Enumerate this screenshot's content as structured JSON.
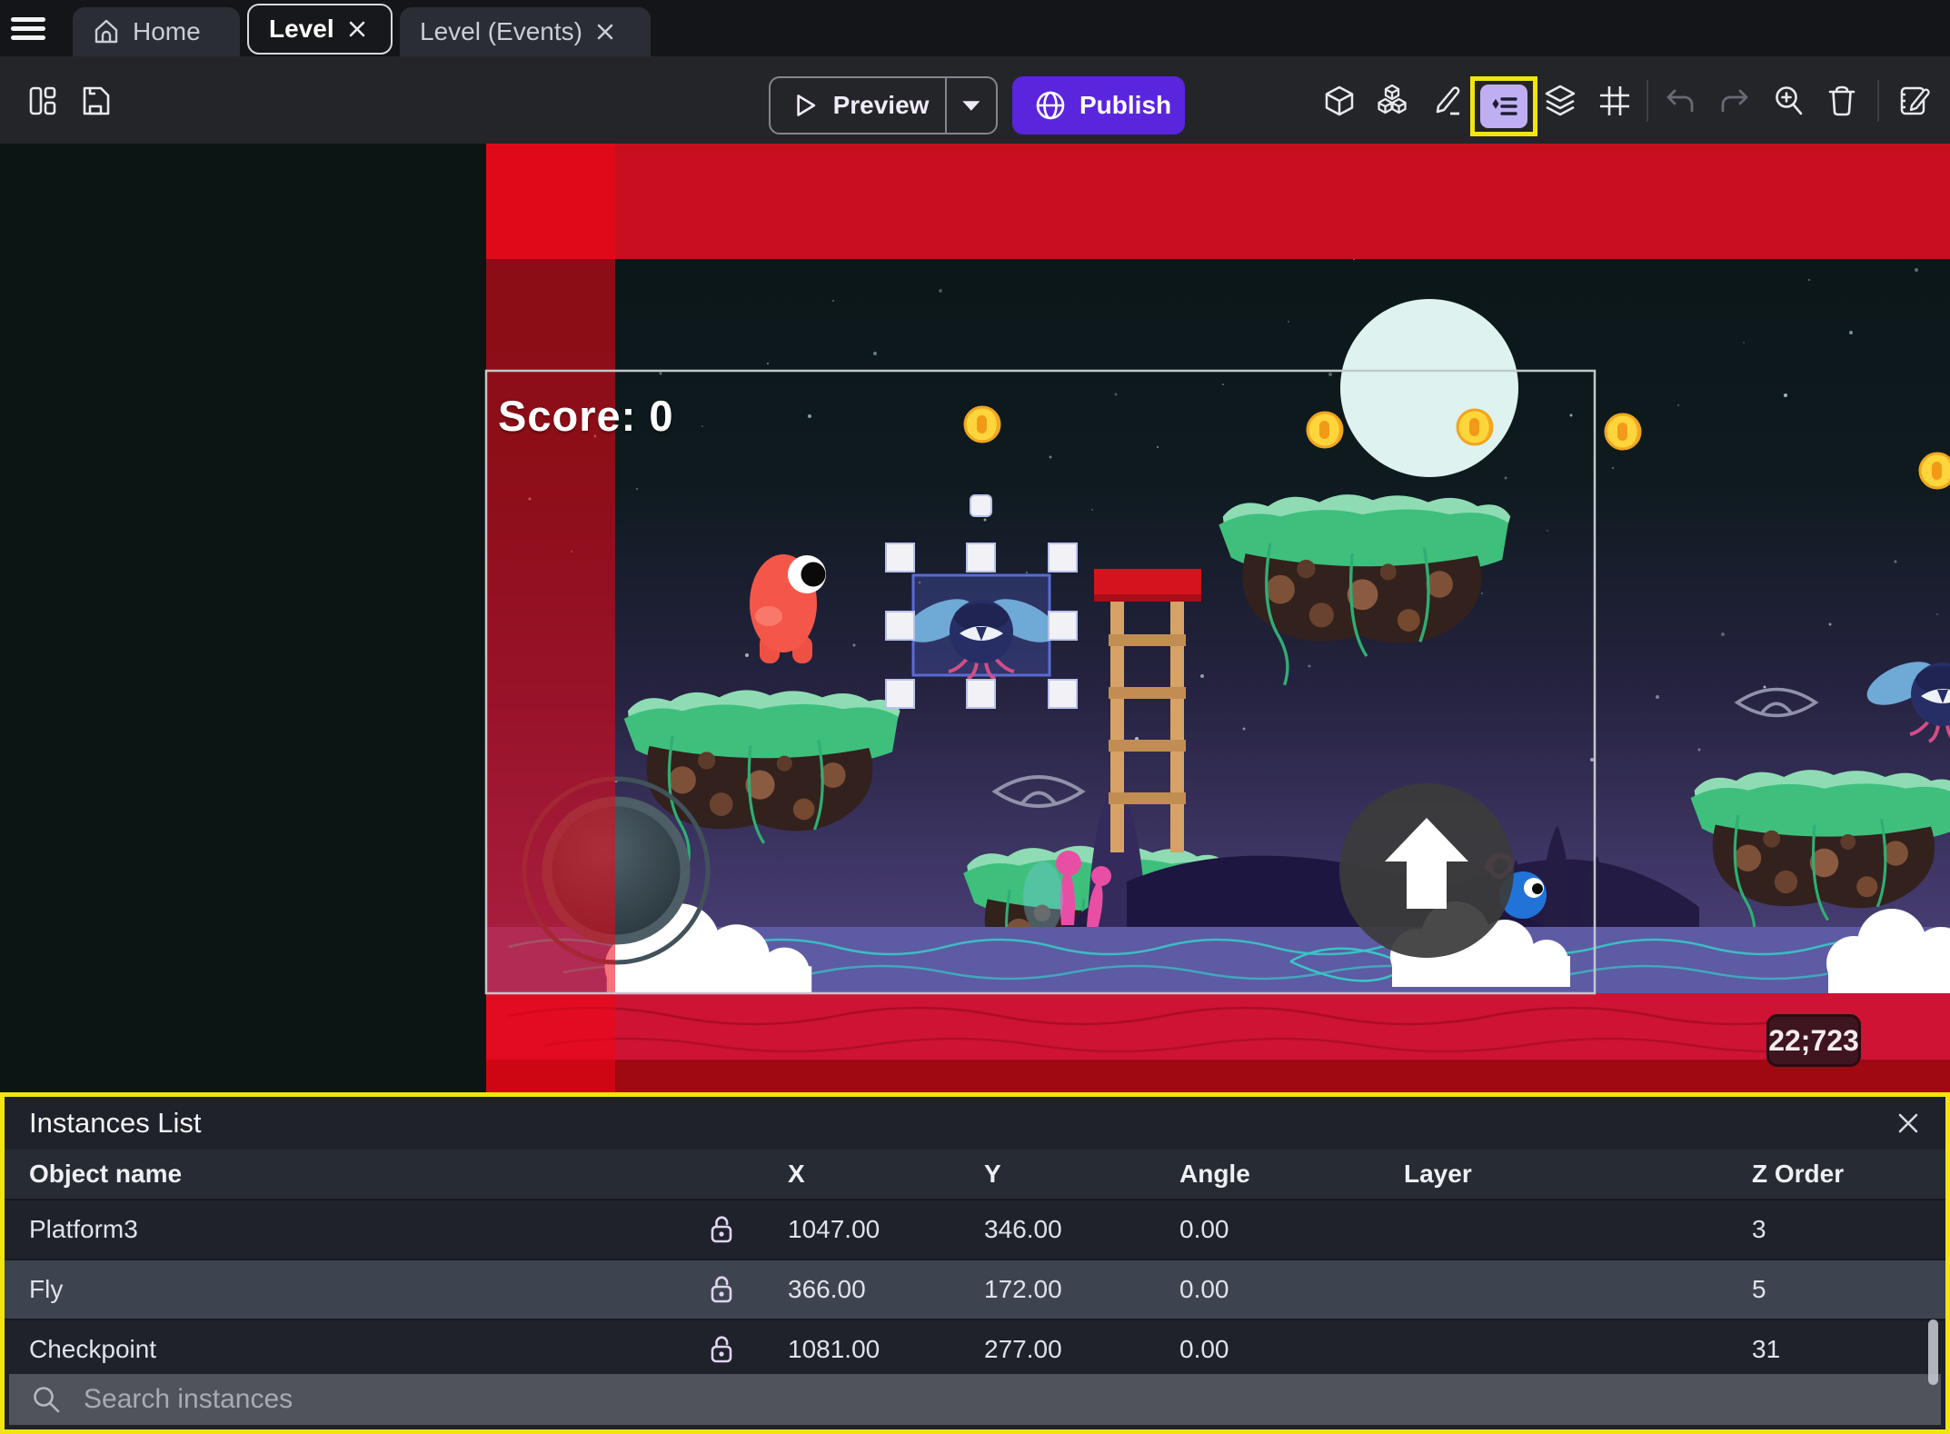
{
  "titlebar": {
    "tabs": [
      {
        "label": "Home"
      },
      {
        "label": "Level"
      },
      {
        "label": "Level (Events)"
      }
    ]
  },
  "toolbar": {
    "preview_label": "Preview",
    "publish_label": "Publish"
  },
  "canvas": {
    "score_text": "Score: 0",
    "coords_badge": "22;723"
  },
  "instances_panel": {
    "title": "Instances List",
    "columns": [
      "Object name",
      "X",
      "Y",
      "Angle",
      "Layer",
      "Z Order"
    ],
    "rows": [
      {
        "name": "Platform3",
        "x": "1047.00",
        "y": "346.00",
        "angle": "0.00",
        "layer": "",
        "z": "3"
      },
      {
        "name": "Fly",
        "x": "366.00",
        "y": "172.00",
        "angle": "0.00",
        "layer": "",
        "z": "5"
      },
      {
        "name": "Checkpoint",
        "x": "1081.00",
        "y": "277.00",
        "angle": "0.00",
        "layer": "",
        "z": "31"
      }
    ],
    "search_placeholder": "Search instances"
  },
  "icons": {
    "menu": "hamburger",
    "home": "house",
    "close": "x",
    "layout": "panels",
    "save": "floppy",
    "play": "triangle",
    "caret": "chevron-down",
    "globe": "sphere",
    "objects": "cube",
    "object_groups": "cubes",
    "edit": "pencil",
    "instances_list": "list-diamond",
    "layers": "stack",
    "grid": "hash",
    "undo": "arrow-undo",
    "redo": "arrow-redo",
    "zoom": "magnifier-plus",
    "delete": "trash",
    "events_editor": "notebook-pencil",
    "search": "magnifier",
    "lock": "padlock-open"
  },
  "colors": {
    "accent_purple": "#5a25dd",
    "highlight_yellow": "#f2e40e",
    "selection_blue": "#5b6bd5",
    "overlay_red": "#c90f1f",
    "selected_row": "#3d4450"
  }
}
